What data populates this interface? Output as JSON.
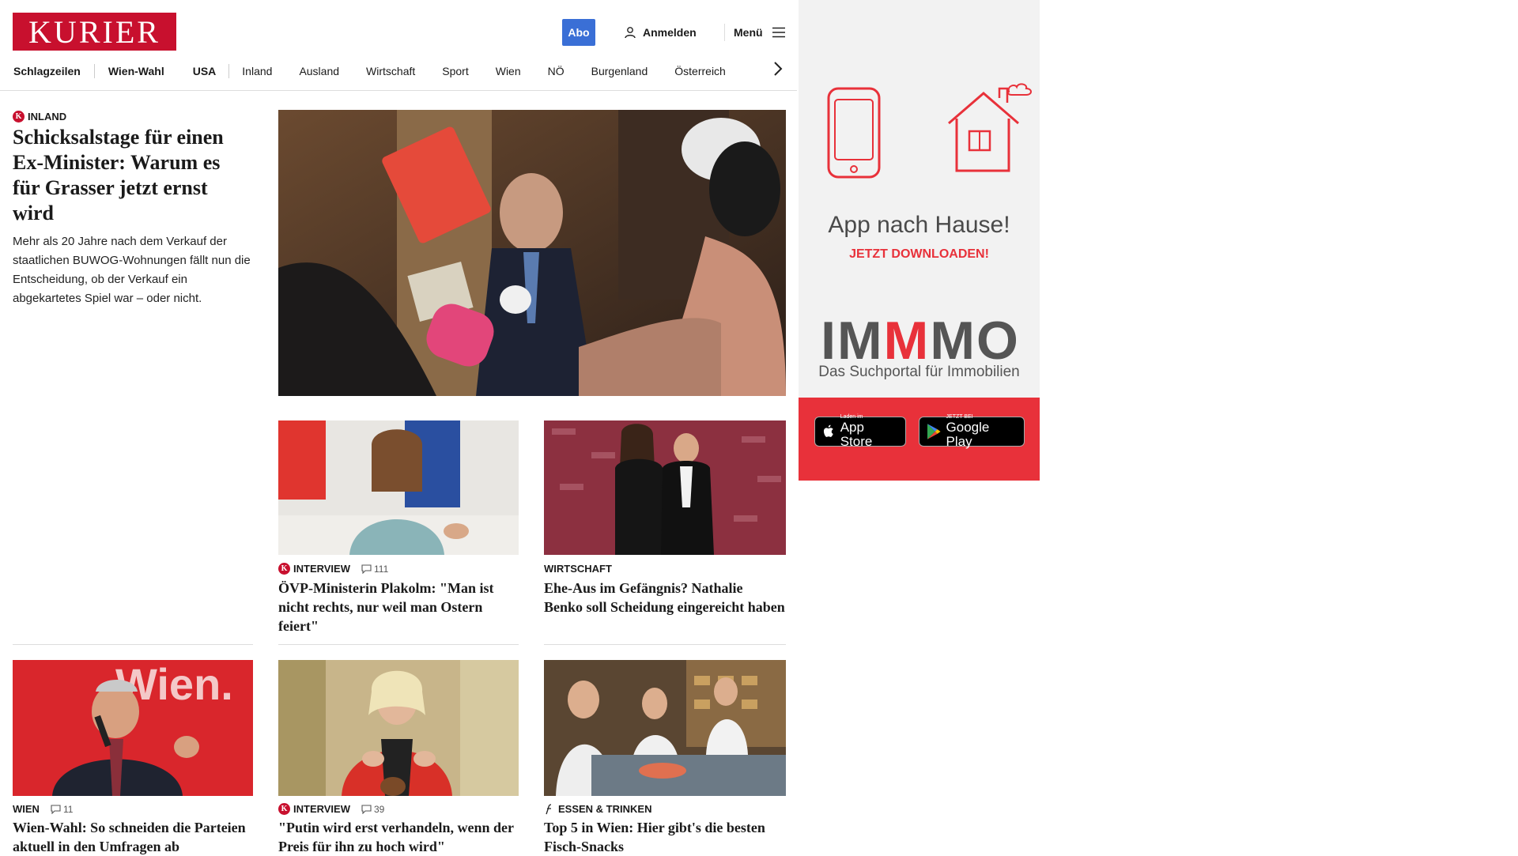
{
  "header": {
    "logo": "KURIER",
    "abo_label": "Abo",
    "login_label": "Anmelden",
    "menu_label": "Menü"
  },
  "nav": {
    "items": [
      "Schlagzeilen",
      "Wien-Wahl",
      "USA",
      "Inland",
      "Ausland",
      "Wirtschaft",
      "Sport",
      "Wien",
      "NÖ",
      "Burgenland",
      "Österreich"
    ]
  },
  "lead": {
    "category": "INLAND",
    "title": "Schicksalstage für einen Ex-Minister: Warum es für Grasser jetzt ernst wird",
    "text": "Mehr als 20 Jahre nach dem Verkauf der staatlichen BUWOG-Wohnungen fällt nun die Entscheidung, ob der Verkauf ein abgekartetes Spiel war – oder nicht."
  },
  "articles": [
    {
      "category": "INTERVIEW",
      "comments": "111",
      "title": "ÖVP-Ministerin Plakolm: \"Man ist nicht rechts, nur weil man Ostern feiert\""
    },
    {
      "category": "WIRTSCHAFT",
      "comments": "",
      "title": "Ehe-Aus im Gefängnis? Nathalie Benko soll Scheidung eingereicht haben"
    },
    {
      "category": "WIEN",
      "comments": "11",
      "title": "Wien-Wahl: So schneiden die Parteien aktuell in den Umfragen ab"
    },
    {
      "category": "INTERVIEW",
      "comments": "39",
      "title": "\"Putin wird erst verhandeln, wenn der Preis für ihn zu hoch wird\""
    },
    {
      "category": "ESSEN & TRINKEN",
      "comments": "",
      "title": "Top 5 in Wien: Hier gibt's die besten Fisch-Snacks"
    }
  ],
  "ad": {
    "headline": "App nach Hause!",
    "cta": "JETZT DOWNLOADEN!",
    "brand_a": "IM",
    "brand_b": "M",
    "brand_c": "MO",
    "brand_sub": "Das Suchportal für Immobilien",
    "appstore_small": "Laden im",
    "appstore_big": "App Store",
    "play_small": "JETZT BEI",
    "play_big": "Google Play"
  },
  "colors": {
    "brand_red": "#c8102e",
    "abo_blue": "#3a6fd6",
    "ad_red": "#e8313a"
  }
}
